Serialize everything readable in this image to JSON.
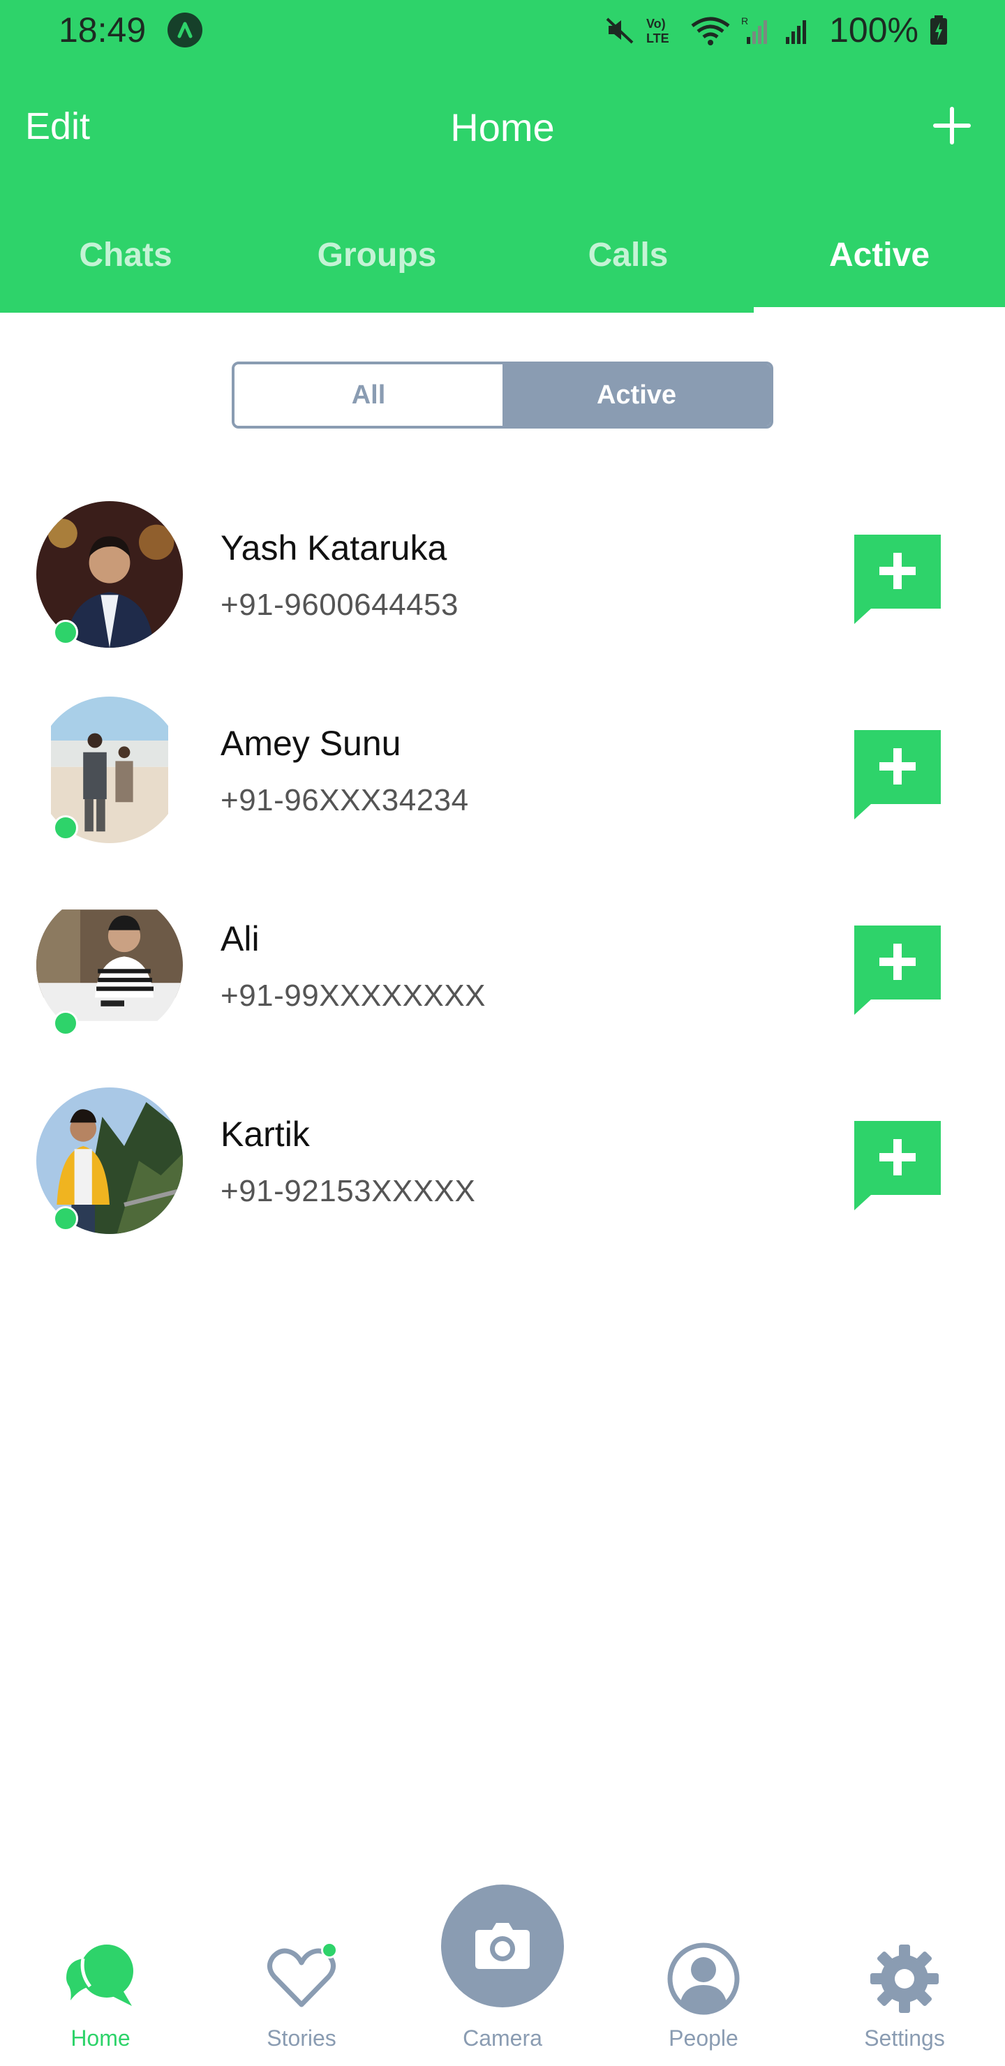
{
  "status_bar": {
    "time": "18:49",
    "battery": "100%",
    "icons": [
      "app-notification-icon",
      "mute-icon",
      "volte-icon",
      "wifi-icon",
      "signal-icon",
      "signal-icon",
      "battery-charging-icon"
    ]
  },
  "header": {
    "edit_label": "Edit",
    "title": "Home",
    "add_icon": "plus-icon"
  },
  "tabs": [
    {
      "label": "Chats",
      "active": false
    },
    {
      "label": "Groups",
      "active": false
    },
    {
      "label": "Calls",
      "active": false
    },
    {
      "label": "Active",
      "active": true
    }
  ],
  "segmented": {
    "options": [
      "All",
      "Active"
    ],
    "selected": "Active"
  },
  "contacts": [
    {
      "name": "Yash Kataruka",
      "phone": "+91-9600644453",
      "online": true
    },
    {
      "name": "Amey Sunu",
      "phone": "+91-96XXX34234",
      "online": true
    },
    {
      "name": "Ali",
      "phone": "+91-99XXXXXXXX",
      "online": true
    },
    {
      "name": "Kartik",
      "phone": "+91-92153XXXXX",
      "online": true
    }
  ],
  "bottom_nav": [
    {
      "label": "Home",
      "icon": "chat-bubbles-icon",
      "active": true
    },
    {
      "label": "Stories",
      "icon": "heart-icon",
      "active": false
    },
    {
      "label": "Camera",
      "icon": "camera-icon",
      "active": false
    },
    {
      "label": "People",
      "icon": "person-icon",
      "active": false
    },
    {
      "label": "Settings",
      "icon": "gear-icon",
      "active": false
    }
  ],
  "colors": {
    "brand_green": "#2ed36a",
    "inactive_gray": "#8a9cb2",
    "text_dark": "#111111",
    "text_muted": "#555555"
  }
}
